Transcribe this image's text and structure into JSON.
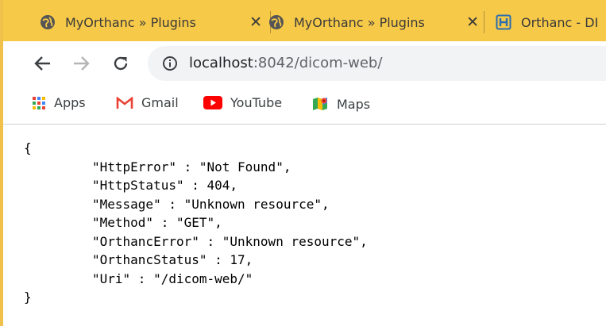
{
  "tabs": [
    {
      "title": "MyOrthanc » Plugins",
      "close": "✕"
    },
    {
      "title": "MyOrthanc » Plugins",
      "close": "✕"
    },
    {
      "title": "Orthanc - DI"
    }
  ],
  "address": {
    "host": "localhost",
    "rest": ":8042/dicom-web/"
  },
  "bookmarks": [
    {
      "label": "Apps",
      "icon": "apps-grid-icon"
    },
    {
      "label": "Gmail",
      "icon": "gmail-icon"
    },
    {
      "label": "YouTube",
      "icon": "youtube-icon"
    },
    {
      "label": "Maps",
      "icon": "maps-icon"
    }
  ],
  "response": {
    "open": "{",
    "lines": [
      "\"HttpError\" : \"Not Found\",",
      "\"HttpStatus\" : 404,",
      "\"Message\" : \"Unknown resource\",",
      "\"Method\" : \"GET\",",
      "\"OrthancError\" : \"Unknown resource\",",
      "\"OrthancStatus\" : 17,",
      "\"Uri\" : \"/dicom-web/\""
    ],
    "close": "}"
  },
  "colors": {
    "tabstrip": "#f7c948",
    "omnibox": "#f1f3f4"
  }
}
